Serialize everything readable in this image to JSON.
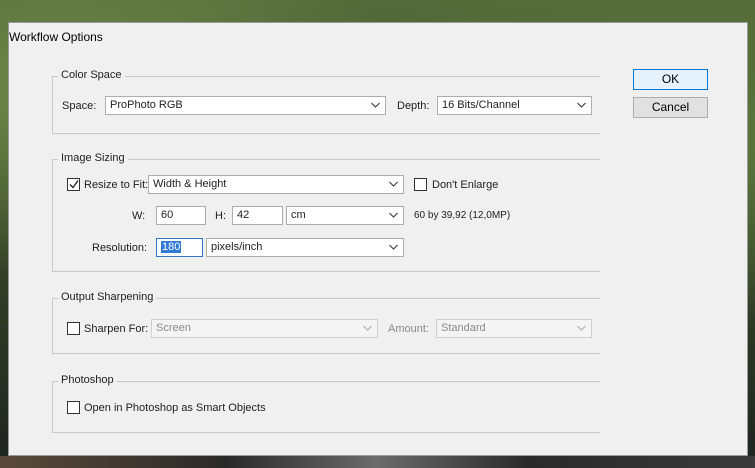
{
  "dialog": {
    "title": "Workflow Options"
  },
  "buttons": {
    "ok": "OK",
    "cancel": "Cancel"
  },
  "color_space": {
    "legend": "Color Space",
    "space_label": "Space:",
    "space_value": "ProPhoto RGB",
    "depth_label": "Depth:",
    "depth_value": "16 Bits/Channel"
  },
  "image_sizing": {
    "legend": "Image Sizing",
    "resize_label": "Resize to Fit:",
    "resize_checked": true,
    "resize_value": "Width & Height",
    "dont_enlarge_label": "Don't Enlarge",
    "dont_enlarge_checked": false,
    "w_label": "W:",
    "w_value": "60",
    "h_label": "H:",
    "h_value": "42",
    "unit_value": "cm",
    "size_readout": "60 by 39,92 (12,0MP)",
    "resolution_label": "Resolution:",
    "resolution_value": "180",
    "resolution_unit": "pixels/inch"
  },
  "output_sharpening": {
    "legend": "Output Sharpening",
    "sharpen_label": "Sharpen For:",
    "sharpen_checked": false,
    "sharpen_value": "Screen",
    "amount_label": "Amount:",
    "amount_value": "Standard"
  },
  "photoshop": {
    "legend": "Photoshop",
    "smart_objects_label": "Open in Photoshop as Smart Objects",
    "smart_objects_checked": false
  }
}
